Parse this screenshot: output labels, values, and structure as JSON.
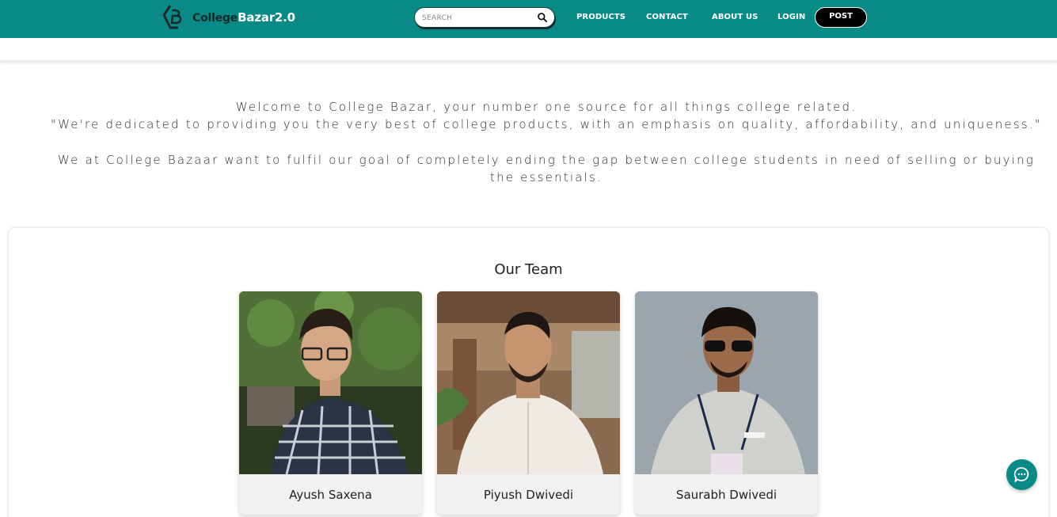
{
  "header": {
    "brand_part1": "College",
    "brand_part2": "Bazar2.0",
    "search_placeholder": "SEARCH",
    "nav": {
      "products": "PRODUCTS",
      "contact": "CONTACT",
      "about": "ABOUT US",
      "login": "LOGIN",
      "post": "POST"
    }
  },
  "about": {
    "line1": "Welcome to College Bazar, your number one source for all things college related.",
    "line2": "\"We're dedicated to providing you the very best of college products, with an emphasis on quality, affordability, and uniqueness.\"",
    "line3": "We at College Bazaar want to fulfil our goal of completely ending the gap between college students in need of selling or buying the essentials."
  },
  "team": {
    "title": "Our Team",
    "members": [
      {
        "name": "Ayush Saxena"
      },
      {
        "name": "Piyush Dwivedi"
      },
      {
        "name": "Saurabh Dwivedi"
      }
    ]
  },
  "icons": {
    "logo": "college-bazar-logo-icon",
    "search": "search-icon",
    "chat": "chat-bubble-icon"
  },
  "colors": {
    "primary": "#0a8a86",
    "post_button": "#000000",
    "card_footer": "#f1f1f1"
  }
}
